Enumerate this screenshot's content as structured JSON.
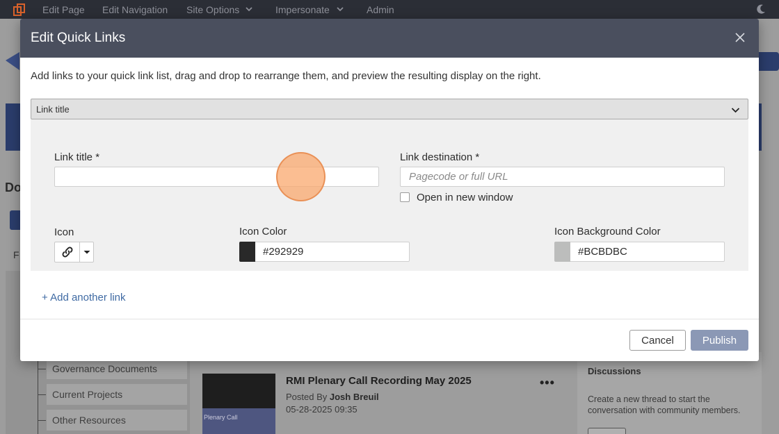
{
  "topbar": {
    "items": [
      {
        "label": "Edit Page"
      },
      {
        "label": "Edit Navigation"
      },
      {
        "label": "Site Options"
      },
      {
        "label": "Impersonate"
      },
      {
        "label": "Admin"
      }
    ],
    "icons": {
      "logo": "site-logo-icon",
      "theme": "moon-icon"
    }
  },
  "background": {
    "heading_fragment": "Do",
    "filter_fragment": "F",
    "sidebar": [
      "Governance Documents",
      "Current Projects",
      "Other Resources"
    ],
    "thumb_text": "Plenary Call",
    "post": {
      "title": "RMI Plenary Call Recording May 2025",
      "posted_by_prefix": "Posted By ",
      "author": "Josh Breuil",
      "datetime": "05-28-2025 09:35",
      "menu": "•••"
    },
    "discussions": {
      "title": "Discussions",
      "text": "Create a new thread to start the conversation with community members."
    }
  },
  "modal": {
    "title": "Edit Quick Links",
    "description": "Add links to your quick link list, drag and drop to rearrange them, and preview the resulting display on the right.",
    "accordion_title": "Link title",
    "form": {
      "link_title_label": "Link title *",
      "link_title_value": "",
      "link_destination_label": "Link destination *",
      "link_destination_placeholder": "Pagecode or full URL",
      "new_window_label": "Open in new window",
      "new_window_checked": false,
      "icon_label": "Icon",
      "icon_selected": "link-icon",
      "icon_color_label": "Icon Color",
      "icon_color_value": "#292929",
      "icon_bg_label": "Icon Background Color",
      "icon_bg_value": "#BCBDBC"
    },
    "add_another": "+ Add another link",
    "buttons": {
      "cancel": "Cancel",
      "publish": "Publish"
    }
  },
  "colors": {
    "header": "#4a4f5e",
    "accent_link": "#3f6aa3",
    "publish_button": "#8b98b5",
    "topbar": "#2b2e36"
  }
}
